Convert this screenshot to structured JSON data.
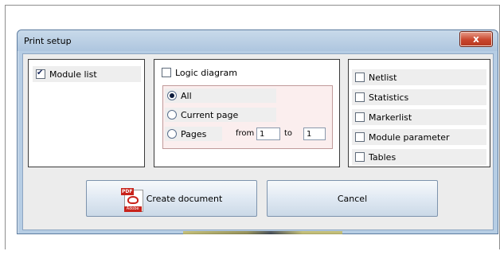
{
  "dialog": {
    "title": "Print setup",
    "close_glyph": "x"
  },
  "module_list": {
    "label": "Module list",
    "checked": true
  },
  "logic_diagram": {
    "label": "Logic diagram",
    "checked": false,
    "radios": [
      {
        "label": "All",
        "selected": true
      },
      {
        "label": "Current page",
        "selected": false
      },
      {
        "label": "Pages",
        "selected": false
      }
    ],
    "from_label": "from",
    "from_value": "1",
    "to_label": "to",
    "to_value": "1"
  },
  "options": [
    {
      "label": "Netlist",
      "checked": false
    },
    {
      "label": "Statistics",
      "checked": false
    },
    {
      "label": "Markerlist",
      "checked": false
    },
    {
      "label": "Module parameter",
      "checked": false
    },
    {
      "label": "Tables",
      "checked": false
    }
  ],
  "buttons": {
    "create_label": "Create document",
    "cancel_label": "Cancel",
    "pdf_tag": "PDF",
    "pdf_brand": "Adobe"
  },
  "icons": {
    "close": "close-icon",
    "pdf": "pdf-document-icon"
  },
  "colors": {
    "titlebar": "#b6cde4",
    "close_button": "#c9462d",
    "subpanel": "#fbeeee"
  }
}
